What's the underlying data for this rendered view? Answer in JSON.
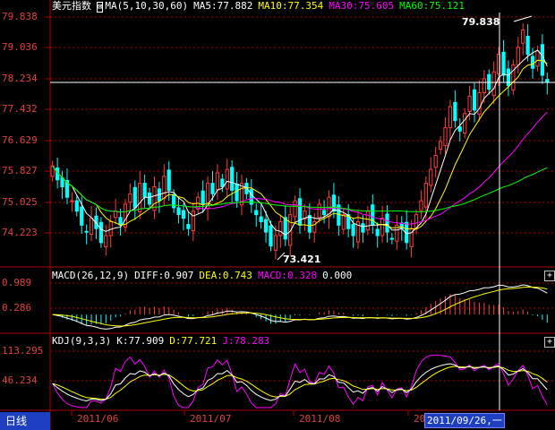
{
  "main": {
    "title": "美元指数",
    "ma_params": "MA(5,10,30,60)",
    "ma5": "MA5:77.882",
    "ma10": "MA10:77.354",
    "ma30": "MA30:75.605",
    "ma60": "MA60:75.121",
    "y_labels": [
      "79.838",
      "79.036",
      "78.234",
      "77.432",
      "76.629",
      "75.827",
      "75.025",
      "74.223"
    ],
    "high_label": "79.838",
    "low_label": "73.421"
  },
  "macd": {
    "params": "MACD(26,12,9)",
    "diff": "DIFF:0.907",
    "dea": "DEA:0.743",
    "macd": "MACD:0.328",
    "zero": "0.000",
    "y_labels": [
      "0.989",
      "0.286"
    ]
  },
  "kdj": {
    "params": "KDJ(9,3,3)",
    "k": "K:77.909",
    "d": "D:77.721",
    "j": "J:78.283",
    "y_labels": [
      "113.295",
      "46.234"
    ]
  },
  "x_labels": [
    "2011/06",
    "2011/07",
    "2011/08",
    "2011/09"
  ],
  "cursor_date": "2011/09/26,一",
  "period_tab": "日线",
  "colors": {
    "up": "#ff3c3c",
    "down": "#00ffff",
    "ma5": "#ffffff",
    "ma10": "#ffff00",
    "ma30": "#ff00ff",
    "ma60": "#00ff00",
    "grid": "#b00000"
  },
  "chart_data": {
    "type": "candlestick",
    "main_ylim": [
      73.0,
      80.3
    ],
    "closes": [
      75.9,
      75.5,
      75.3,
      75.0,
      74.9,
      74.6,
      74.2,
      74.0,
      74.4,
      74.1,
      73.7,
      73.9,
      74.3,
      74.6,
      74.2,
      74.8,
      75.1,
      74.7,
      75.4,
      75.0,
      74.8,
      75.3,
      74.9,
      75.6,
      75.2,
      74.7,
      74.5,
      74.4,
      74.1,
      74.6,
      75.0,
      74.8,
      75.4,
      75.1,
      75.7,
      75.3,
      75.8,
      75.2,
      74.9,
      75.4,
      75.1,
      74.8,
      74.5,
      74.3,
      74.0,
      73.6,
      73.9,
      74.3,
      73.8,
      74.5,
      74.9,
      74.2,
      74.6,
      74.0,
      74.3,
      74.8,
      74.5,
      75.0,
      74.6,
      74.2,
      74.5,
      74.1,
      73.9,
      74.3,
      74.0,
      74.6,
      74.2,
      73.9,
      74.4,
      74.0,
      73.8,
      74.2,
      74.1,
      73.7,
      74.1,
      74.5,
      74.9,
      75.4,
      75.8,
      76.2,
      76.6,
      77.0,
      77.6,
      77.2,
      76.9,
      77.4,
      77.9,
      77.5,
      78.0,
      78.4,
      78.1,
      78.6,
      79.1,
      78.5,
      78.2,
      78.8,
      79.3,
      79.8,
      79.1,
      78.7,
      79.2,
      78.5,
      78.3
    ],
    "kdj_ylim": [
      0,
      125
    ],
    "macd_ylim": [
      -0.6,
      1.15
    ]
  }
}
